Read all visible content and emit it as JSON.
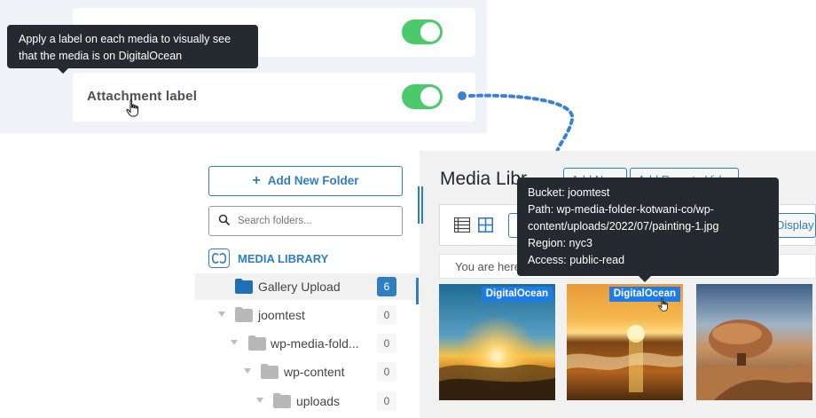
{
  "settings": {
    "attachment_label": "Attachment label",
    "tooltip": "Apply a label on each media to visually see that the media is on DigitalOcean",
    "tooltip_line1": "Apply a label on each media to visually see",
    "tooltip_line2": "that the media is on DigitalOcean",
    "toggle_1_on": true,
    "toggle_2_on": true,
    "toggle_color": "#4cca6b"
  },
  "sidebar": {
    "add_folder": "Add New Folder",
    "search_placeholder": "Search folders...",
    "media_library": "MEDIA LIBRARY",
    "folders": [
      {
        "label": "Gallery Upload",
        "count": "6",
        "active": true
      },
      {
        "label": "joomtest",
        "count": "0"
      },
      {
        "label": "wp-media-fold...",
        "count": "0"
      },
      {
        "label": "wp-content",
        "count": "0"
      },
      {
        "label": "uploads",
        "count": "0"
      }
    ]
  },
  "main": {
    "title": "Media Library",
    "title_visible": "Media Libr",
    "add_new": "Add New",
    "add_remote_video": "Add Remote Video",
    "display_all": "Display all",
    "breadcrumb": "You are here"
  },
  "media_badge": "DigitalOcean",
  "info_tooltip": {
    "bucket": "Bucket: joomtest",
    "path_line1": "Path: wp-media-folder-kotwani-co/wp-",
    "path_line2": "content/uploads/2022/07/painting-1.jpg",
    "region": "Region: nyc3",
    "access": "Access: public-read"
  },
  "colors": {
    "accent": "#2f7ec2",
    "badge": "#1e7ce8",
    "tooltip_bg": "#252a30",
    "connector": "#3b82d6"
  },
  "icons": {
    "cursor": "hand-pointer-icon",
    "list_view": "list-view-icon",
    "grid_view": "grid-view-icon",
    "search": "search-icon",
    "folder": "folder-icon"
  }
}
